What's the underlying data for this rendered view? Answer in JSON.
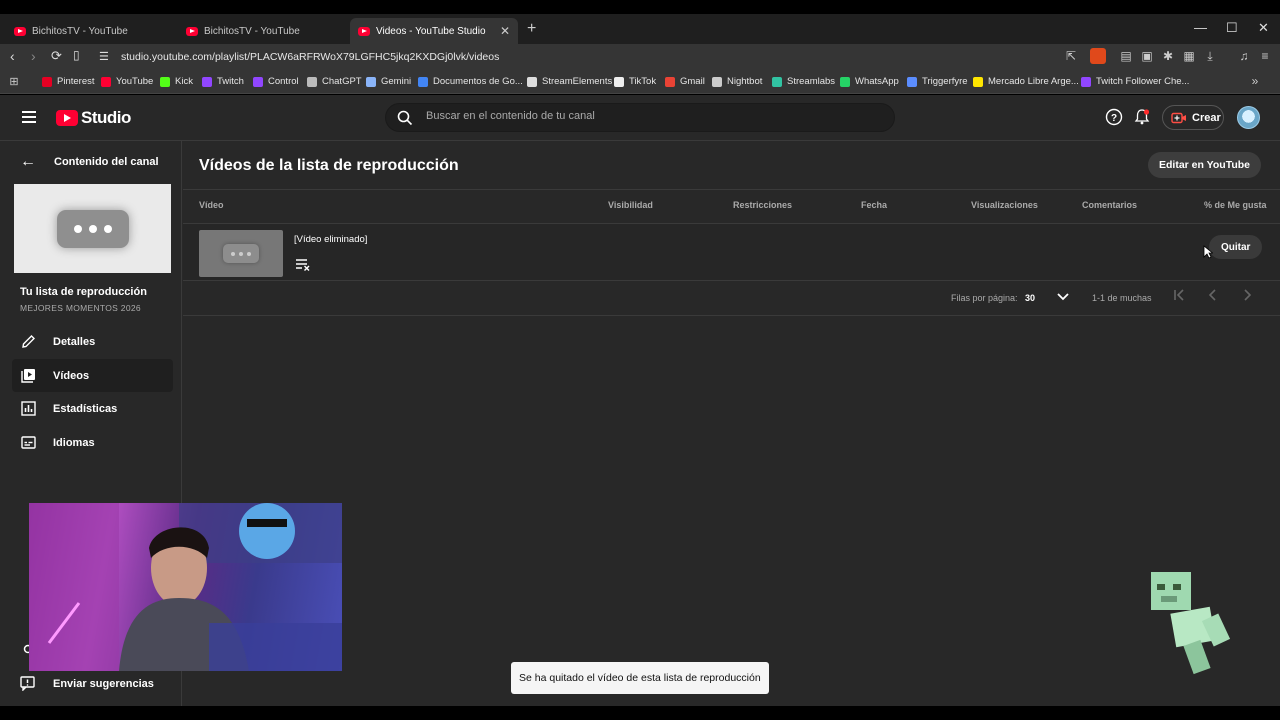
{
  "browser": {
    "tabs": [
      {
        "label": "BichitosTV - YouTube"
      },
      {
        "label": "BichitosTV - YouTube"
      },
      {
        "label": "Videos - YouTube Studio"
      }
    ],
    "url": "studio.youtube.com/playlist/PLACW6aRFRWoX79LGFHC5jkq2KXDGj0lvk/videos",
    "bookmarks": [
      {
        "label": "Pinterest",
        "color": "#e60023"
      },
      {
        "label": "YouTube",
        "color": "#ff0033"
      },
      {
        "label": "Kick",
        "color": "#53fc18"
      },
      {
        "label": "Twitch",
        "color": "#9146ff"
      },
      {
        "label": "Control",
        "color": "#9146ff"
      },
      {
        "label": "ChatGPT",
        "color": "#bbbbbb"
      },
      {
        "label": "Gemini",
        "color": "#8ab4f8"
      },
      {
        "label": "Documentos de Go...",
        "color": "#4285f4"
      },
      {
        "label": "StreamElements",
        "color": "#dddddd"
      },
      {
        "label": "TikTok",
        "color": "#eeeeee"
      },
      {
        "label": "Gmail",
        "color": "#ea4335"
      },
      {
        "label": "Nightbot",
        "color": "#cccccc"
      },
      {
        "label": "Streamlabs",
        "color": "#31c3a2"
      },
      {
        "label": "WhatsApp",
        "color": "#25d366"
      },
      {
        "label": "Triggerfyre",
        "color": "#5b8dff"
      },
      {
        "label": "Mercado Libre Arge...",
        "color": "#ffe600"
      },
      {
        "label": "Twitch Follower Che...",
        "color": "#9146ff"
      }
    ]
  },
  "studio": {
    "logo_text": "Studio",
    "search_placeholder": "Buscar en el contenido de tu canal",
    "create_label": "Crear",
    "sidebar": {
      "back_label": "Contenido del canal",
      "playlist_title": "Tu lista de reproducción",
      "playlist_subtitle": "MEJORES MOMENTOS 2026",
      "items": [
        {
          "label": "Detalles"
        },
        {
          "label": "Vídeos"
        },
        {
          "label": "Estadísticas"
        },
        {
          "label": "Idiomas"
        }
      ],
      "feedback_label": "Enviar sugerencias"
    },
    "main": {
      "title": "Vídeos de la lista de reproducción",
      "edit_button": "Editar en YouTube",
      "columns": [
        "Vídeo",
        "Visibilidad",
        "Restricciones",
        "Fecha",
        "Visualizaciones",
        "Comentarios",
        "% de Me gusta"
      ],
      "rows": [
        {
          "title": "[Vídeo eliminado]",
          "action": "Quitar"
        }
      ],
      "pagination": {
        "rows_label": "Filas por página:",
        "rows_value": "30",
        "range": "1-1 de muchas"
      }
    },
    "toast": "Se ha quitado el vídeo de esta lista de reproducción"
  }
}
